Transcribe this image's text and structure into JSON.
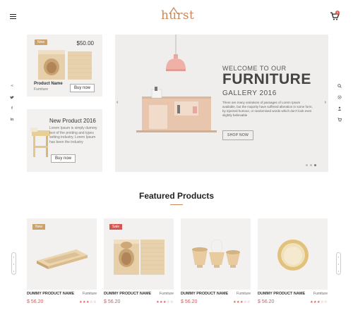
{
  "header": {
    "logo": "hurst",
    "menu_icon": "hamburger-icon",
    "cart_icon": "cart-icon",
    "cart_count": "0"
  },
  "social_left": [
    {
      "icon": "share-icon",
      "glyph": "⋖"
    },
    {
      "icon": "twitter-icon",
      "glyph": "🐦"
    },
    {
      "icon": "facebook-icon",
      "glyph": "f"
    },
    {
      "icon": "linkedin-icon",
      "glyph": "in"
    }
  ],
  "tools_right": [
    {
      "icon": "search-icon",
      "glyph": "⌕"
    },
    {
      "icon": "settings-icon",
      "glyph": "⚙"
    },
    {
      "icon": "user-icon",
      "glyph": "👤"
    },
    {
      "icon": "cart-icon",
      "glyph": "🛒"
    }
  ],
  "promo1": {
    "tag": "New",
    "price": "$50.00",
    "name": "Product Name",
    "category": "Furniture",
    "button": "Buy now"
  },
  "promo2": {
    "title": "New Product 2016",
    "description": "Lorem Ipsum is simply dummy text of the printing and types setting industry. Lorem Ipsum has been the industry",
    "button": "Buy now"
  },
  "hero": {
    "welcome": "WELCOME TO OUR",
    "title": "FURNITURE",
    "subtitle": "GALLERY 2016",
    "body": "There are many variations of passages of Lorem Ipsum available, but the majority have suffered alteration in some form, by injected humour, or randomised words which don't look even slightly believable",
    "button": "SHOP NOW",
    "prev": "‹",
    "next": "›"
  },
  "featured": {
    "title": "Featured Products",
    "products": [
      {
        "tag": "New",
        "tag_color": "#c9a36b",
        "name": "DUMMY PRODUCT NAME",
        "category": "Furniture",
        "price": "$ 56.20",
        "stars": "★★★☆☆",
        "image": "wooden-tray"
      },
      {
        "tag": "Sale",
        "tag_color": "#d9534f",
        "name": "DUMMY PRODUCT NAME",
        "category": "Furniture",
        "price": "$ 56.20",
        "stars": "★★★☆☆",
        "image": "wooden-box"
      },
      {
        "tag": "",
        "tag_color": "",
        "name": "DUMMY PRODUCT NAME",
        "category": "Furniture",
        "price": "$ 56.20",
        "stars": "★★★☆☆",
        "image": "egg-cups"
      },
      {
        "tag": "",
        "tag_color": "",
        "name": "DUMMY PRODUCT NAME",
        "category": "Furniture",
        "price": "$ 56.20",
        "stars": "★★★☆☆",
        "image": "wooden-bowl"
      }
    ]
  },
  "colors": {
    "accent": "#c9895d",
    "price": "#e0584f",
    "card_bg": "#f2f1ef"
  }
}
